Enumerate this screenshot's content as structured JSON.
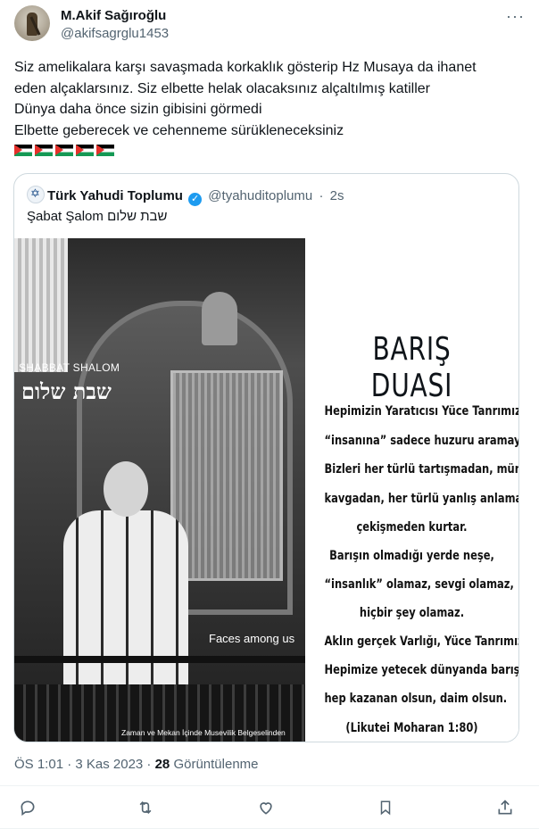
{
  "author": {
    "name": "M.Akif Sağıroğlu",
    "handle": "@akifsagrglu1453",
    "more": "···"
  },
  "tweet_lines": [
    "Siz amelikalara karşı savaşmada korkaklık gösterip Hz Musaya da ihanet",
    "eden alçaklarsınız. Siz elbette helak olacaksınız alçaltılmış katiller",
    "Dünya daha önce sizin gibisini görmedi",
    "Elbette geberecek ve cehenneme sürükleneceksiniz"
  ],
  "flags": [
    "palestine-flag",
    "palestine-flag",
    "palestine-flag",
    "palestine-flag",
    "palestine-flag"
  ],
  "quote": {
    "name": "Türk Yahudi Toplumu",
    "verified": "✓",
    "handle": "@tyahuditoplumu",
    "separator": "·",
    "time": "2s",
    "text": "Şabat Şalom  שבת שלום",
    "photo": {
      "label": "SHABBAT SHALOM",
      "hebrew": "שבת שלום",
      "faces": "Faces among us",
      "credit": "Zaman ve Mekan İçinde Musevilik Belgeselinden"
    },
    "poster": {
      "title": "BARIŞ DUASI",
      "lines": [
        "Hepimizin Yaratıcısı Yüce Tanrımız;",
        "“insanına” sadece huzuru aramayı öğret.",
        "Bizleri her türlü tartışmadan, münakaşadan,",
        "kavgadan, her türlü yanlış anlama ve",
        "çekişmeden kurtar.",
        "Barışın olmadığı yerde neşe,",
        "“insanlık” olamaz, sevgi olamaz,",
        "hiçbir şey olamaz.",
        "Aklın gerçek Varlığı, Yüce Tanrımız,",
        "Hepimize yetecek dünyanda barış",
        "hep kazanan olsun, daim olsun.",
        "(Likutei Moharan 1:80)"
      ]
    }
  },
  "meta": {
    "time": "ÖS 1:01 · 3 Kas 2023 · ",
    "views": "28",
    "views_label": " Görüntülenme"
  },
  "actions": [
    "reply-icon",
    "retweet-icon",
    "like-icon",
    "bookmark-icon",
    "share-icon"
  ]
}
